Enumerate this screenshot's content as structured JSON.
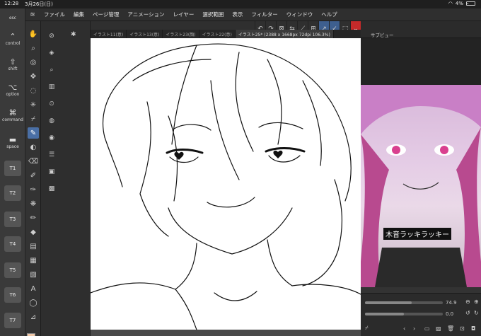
{
  "status_bar": {
    "time": "12:28",
    "date": "3月26日(日)",
    "battery": "4%"
  },
  "menu": {
    "items": [
      "ファイル",
      "編集",
      "ページ管理",
      "アニメーション",
      "レイヤー",
      "選択範囲",
      "表示",
      "フィルター",
      "ウィンドウ",
      "ヘルプ"
    ]
  },
  "keys": {
    "esc": "esc",
    "control": "control",
    "shift": "shift",
    "option": "option",
    "command": "command",
    "space": "space",
    "t_keys": [
      "T1",
      "T2",
      "T3",
      "T4",
      "T5",
      "T6",
      "T7"
    ]
  },
  "tabs": [
    {
      "label": "イラスト11(意)"
    },
    {
      "label": "イラスト13(意)"
    },
    {
      "label": "イラスト23(顔)"
    },
    {
      "label": "イラスト22(意)"
    },
    {
      "label": "イラスト25* (2388 x 1668px 72dpi 106.3%)"
    }
  ],
  "subview": {
    "title": "サブビュー",
    "caption": "木音ラッキラッキー",
    "zoom_value": "74.9",
    "rotation_value": "0.0"
  },
  "colors": {
    "main": "#f2c9a8",
    "sub": "#111111",
    "accent": "#4a6fa5",
    "record": "#c32a2a"
  }
}
